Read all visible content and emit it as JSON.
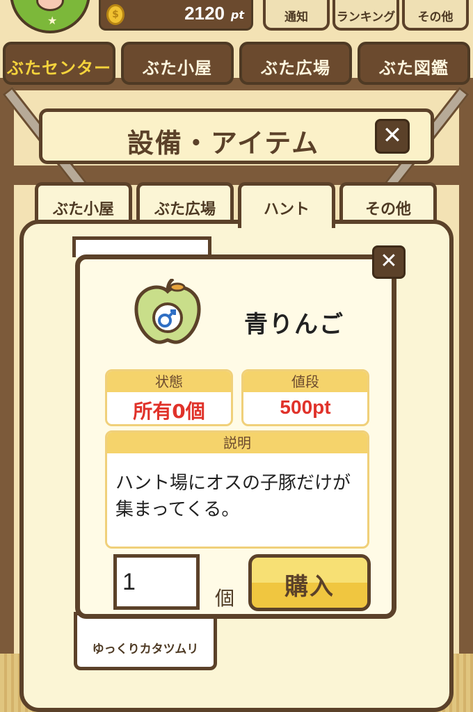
{
  "header": {
    "points_value": "2120",
    "points_unit": "pt",
    "buttons": [
      "通知",
      "ランキング",
      "その他"
    ]
  },
  "categories": [
    "ぶたセンター",
    "ぶた小屋",
    "ぶた広場",
    "ぶた図鑑"
  ],
  "active_category": "ぶたセンター",
  "title": "設備・アイテム",
  "section_tabs": [
    "ぶた小屋",
    "ぶた広場",
    "ハント",
    "その他"
  ],
  "active_section_tab": "ハント",
  "list_item_below": "ゆっくりカタツムリ",
  "dialog": {
    "item_name": "青りんご",
    "item_icon": "male-symbol-apple-icon",
    "status_label": "状態",
    "status_value": "所有0個",
    "price_label": "値段",
    "price_value": "500pt",
    "desc_label": "説明",
    "desc_text": "ハント場にオスの子豚だけが集まってくる。",
    "quantity_value": "1",
    "quantity_unit": "個",
    "buy_label": "購入"
  },
  "colors": {
    "wood_dark": "#5b4129",
    "panel_bg": "#fbf5d5",
    "accent_yellow": "#f5d36b",
    "price_red": "#e0322a"
  }
}
